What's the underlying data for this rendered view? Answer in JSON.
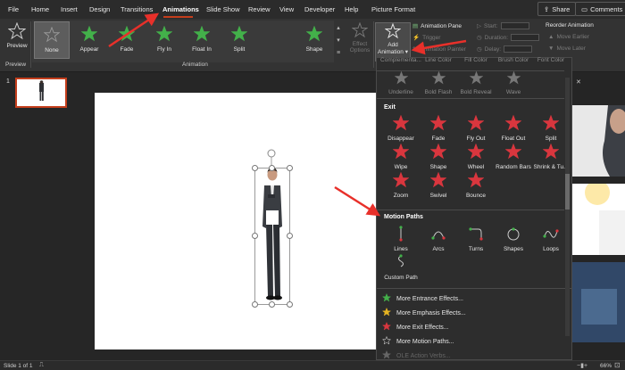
{
  "tabs": [
    {
      "label": "File"
    },
    {
      "label": "Home"
    },
    {
      "label": "Insert"
    },
    {
      "label": "Design"
    },
    {
      "label": "Transitions"
    },
    {
      "label": "Animations"
    },
    {
      "label": "Slide Show"
    },
    {
      "label": "Review"
    },
    {
      "label": "View"
    },
    {
      "label": "Developer"
    },
    {
      "label": "Help"
    },
    {
      "label": "Picture Format"
    }
  ],
  "share_label": "Share",
  "comments_label": "Comments",
  "ribbon": {
    "preview": {
      "label": "Preview",
      "group": "Preview"
    },
    "gallery": [
      {
        "label": "None",
        "color": "#9a9a9a"
      },
      {
        "label": "Appear",
        "color": "#43b04a"
      },
      {
        "label": "Fade",
        "color": "#43b04a"
      },
      {
        "label": "Fly In",
        "color": "#43b04a"
      },
      {
        "label": "Float In",
        "color": "#43b04a"
      },
      {
        "label": "Split",
        "color": "#43b04a"
      },
      {
        "label": "Shape",
        "color": "#43b04a"
      }
    ],
    "effect_options": {
      "line1": "Effect",
      "line2": "Options"
    },
    "group_animation": "Animation",
    "add_animation": {
      "line1": "Add",
      "line2": "Animation"
    },
    "animation_pane": "Animation Pane",
    "trigger": "Trigger",
    "animation_painter": "Animation Painter",
    "start": "Start:",
    "duration": "Duration:",
    "delay": "Delay:",
    "reorder": "Reorder Animation",
    "move_earlier": "Move Earlier",
    "move_later": "Move Later"
  },
  "slide_number": "1",
  "dropdown": {
    "top_row": [
      {
        "label": "Complementa..."
      },
      {
        "label": "Line Color"
      },
      {
        "label": "Fill Color"
      },
      {
        "label": "Brush Color"
      },
      {
        "label": "Font Color"
      }
    ],
    "emphasis_row": [
      {
        "label": "Underline"
      },
      {
        "label": "Bold Flash"
      },
      {
        "label": "Bold Reveal"
      },
      {
        "label": "Wave"
      }
    ],
    "exit_heading": "Exit",
    "exit_items": [
      {
        "label": "Disappear"
      },
      {
        "label": "Fade"
      },
      {
        "label": "Fly Out"
      },
      {
        "label": "Float Out"
      },
      {
        "label": "Split"
      },
      {
        "label": "Wipe"
      },
      {
        "label": "Shape"
      },
      {
        "label": "Wheel"
      },
      {
        "label": "Random Bars"
      },
      {
        "label": "Shrink & Tu..."
      },
      {
        "label": "Zoom"
      },
      {
        "label": "Swivel"
      },
      {
        "label": "Bounce"
      }
    ],
    "motion_heading": "Motion Paths",
    "motion_items": [
      {
        "label": "Lines"
      },
      {
        "label": "Arcs"
      },
      {
        "label": "Turns"
      },
      {
        "label": "Shapes"
      },
      {
        "label": "Loops"
      },
      {
        "label": "Custom Path"
      }
    ],
    "more": [
      {
        "label": "More Entrance Effects...",
        "color": "#43b04a"
      },
      {
        "label": "More Emphasis Effects...",
        "color": "#e6b422"
      },
      {
        "label": "More Exit Effects...",
        "color": "#d9363e"
      },
      {
        "label": "More Motion Paths...",
        "color": "#e6e6e6"
      },
      {
        "label": "OLE Action Verbs...",
        "color": "#666666"
      }
    ]
  },
  "status": {
    "slide_info": "Slide 1 of 1",
    "zoom": "66%"
  },
  "colors": {
    "accent": "#c43e1c",
    "exit_star": "#d9363e",
    "entrance_star": "#43b04a",
    "annotation_arrow": "#e8302a"
  }
}
